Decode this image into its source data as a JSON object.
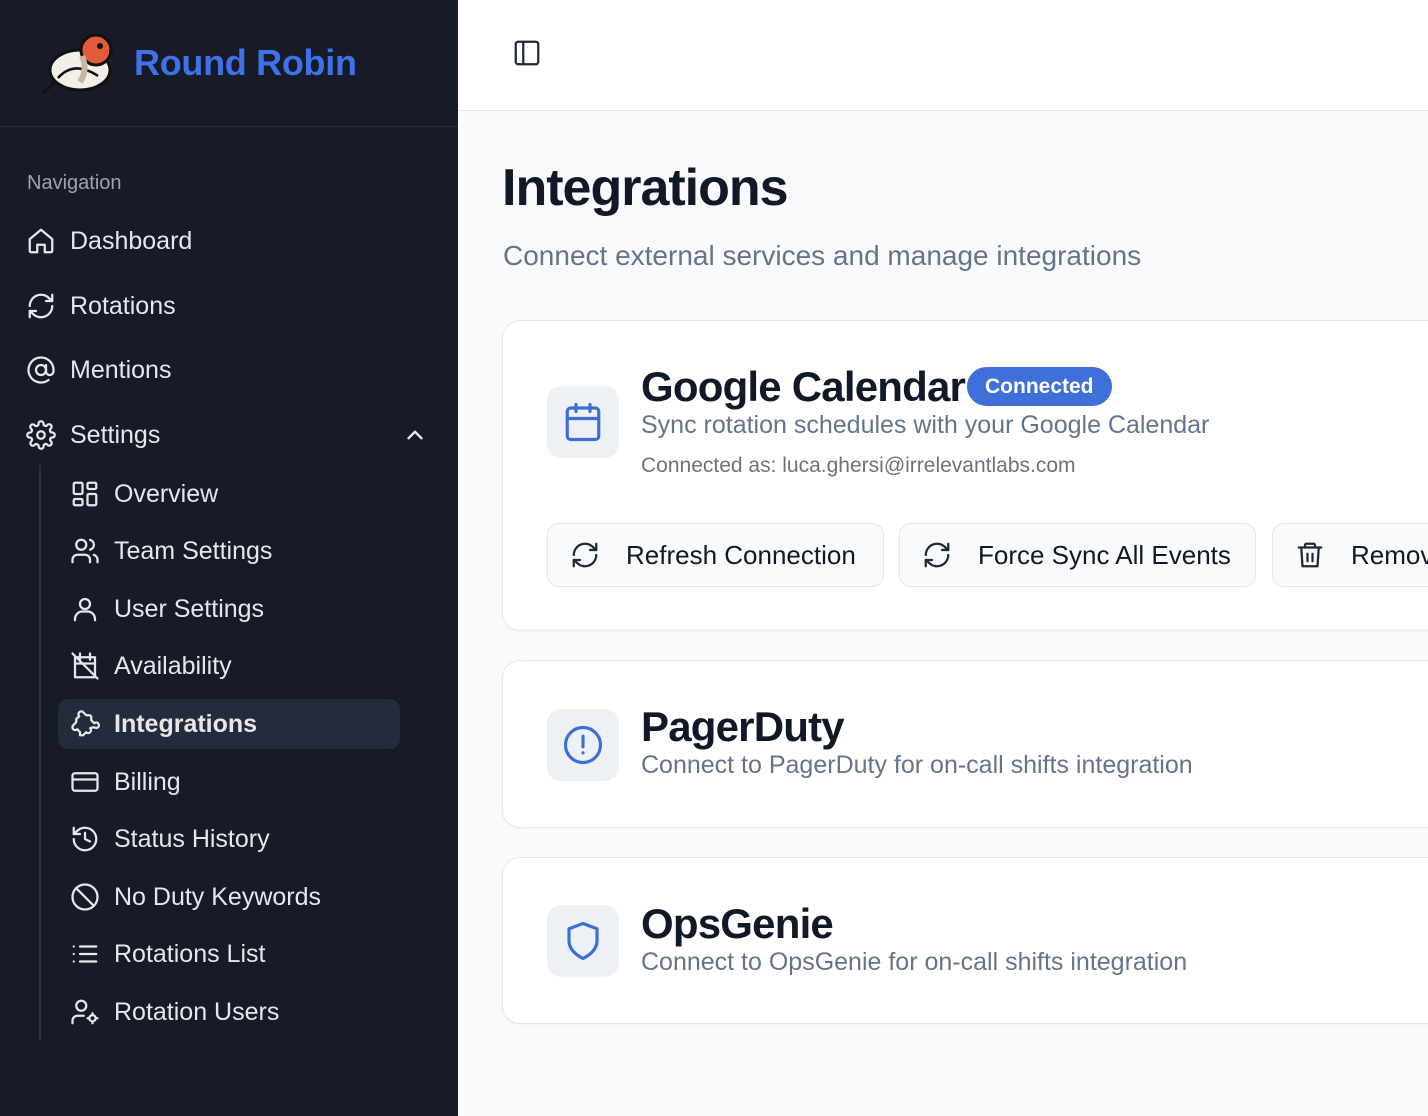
{
  "app": {
    "name": "Round Robin"
  },
  "sidebar": {
    "heading": "Navigation",
    "items": [
      {
        "label": "Dashboard",
        "icon": "home-icon"
      },
      {
        "label": "Rotations",
        "icon": "refresh-icon"
      },
      {
        "label": "Mentions",
        "icon": "at-sign-icon"
      },
      {
        "label": "Settings",
        "icon": "gear-icon",
        "expanded": true
      }
    ],
    "sub_items": [
      {
        "label": "Overview",
        "icon": "grid-icon"
      },
      {
        "label": "Team Settings",
        "icon": "users-icon"
      },
      {
        "label": "User Settings",
        "icon": "user-icon"
      },
      {
        "label": "Availability",
        "icon": "calendar-off-icon"
      },
      {
        "label": "Integrations",
        "icon": "puzzle-icon",
        "active": true
      },
      {
        "label": "Billing",
        "icon": "credit-card-icon"
      },
      {
        "label": "Status History",
        "icon": "history-icon"
      },
      {
        "label": "No Duty Keywords",
        "icon": "ban-icon"
      },
      {
        "label": "Rotations List",
        "icon": "list-icon"
      },
      {
        "label": "Rotation Users",
        "icon": "user-cog-icon"
      }
    ]
  },
  "main": {
    "title": "Integrations",
    "subtitle": "Connect external services and manage integrations",
    "integrations": [
      {
        "name": "Google Calendar",
        "badge": "Connected",
        "description": "Sync rotation schedules with your Google Calendar",
        "connected_as": "Connected as: luca.ghersi@irrelevantlabs.com",
        "actions": [
          "Refresh Connection",
          "Force Sync All Events",
          "Remove"
        ]
      },
      {
        "name": "PagerDuty",
        "description": "Connect to PagerDuty for on-call shifts integration"
      },
      {
        "name": "OpsGenie",
        "description": "Connect to OpsGenie for on-call shifts integration"
      }
    ]
  },
  "colors": {
    "sidebar_bg": "#161b27",
    "brand": "#3f72e8",
    "badge": "#3f6fd8",
    "icon_blue": "#3b6fd6"
  }
}
